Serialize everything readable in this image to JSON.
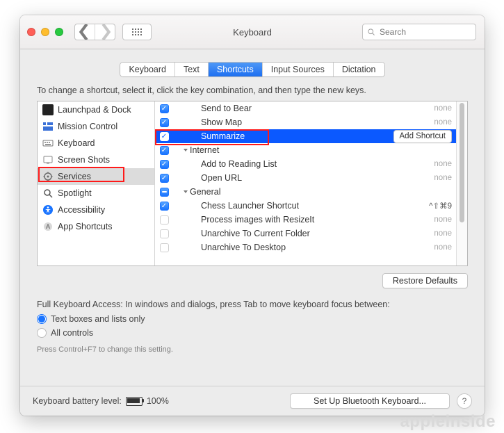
{
  "window": {
    "title": "Keyboard",
    "search_placeholder": "Search"
  },
  "tabs": [
    "Keyboard",
    "Text",
    "Shortcuts",
    "Input Sources",
    "Dictation"
  ],
  "active_tab_index": 2,
  "instructions": "To change a shortcut, select it, click the key combination, and then type the new keys.",
  "sidebar": {
    "items": [
      {
        "label": "Launchpad & Dock",
        "icon": "launchpad-icon"
      },
      {
        "label": "Mission Control",
        "icon": "mission-control-icon"
      },
      {
        "label": "Keyboard",
        "icon": "keyboard-icon"
      },
      {
        "label": "Screen Shots",
        "icon": "screenshots-icon"
      },
      {
        "label": "Services",
        "icon": "services-icon",
        "selected": true
      },
      {
        "label": "Spotlight",
        "icon": "spotlight-icon"
      },
      {
        "label": "Accessibility",
        "icon": "accessibility-icon"
      },
      {
        "label": "App Shortcuts",
        "icon": "app-shortcuts-icon"
      }
    ]
  },
  "tree": [
    {
      "type": "item",
      "checked": true,
      "label": "Send to Bear",
      "shortcut": "none"
    },
    {
      "type": "item",
      "checked": true,
      "label": "Show Map",
      "shortcut": "none"
    },
    {
      "type": "item",
      "checked": true,
      "label": "Summarize",
      "selected": true,
      "add_shortcut": true
    },
    {
      "type": "group",
      "checked": true,
      "label": "Internet",
      "expanded": true
    },
    {
      "type": "item",
      "checked": true,
      "label": "Add to Reading List",
      "shortcut": "none"
    },
    {
      "type": "item",
      "checked": true,
      "label": "Open URL",
      "shortcut": "none"
    },
    {
      "type": "group",
      "checked": "mixed",
      "label": "General",
      "expanded": true
    },
    {
      "type": "item",
      "checked": true,
      "label": "Chess Launcher Shortcut",
      "shortcut": "^⇧⌘9"
    },
    {
      "type": "item",
      "checked": false,
      "label": "Process images with ResizeIt",
      "shortcut": "none"
    },
    {
      "type": "item",
      "checked": false,
      "label": "Unarchive To Current Folder",
      "shortcut": "none"
    },
    {
      "type": "item",
      "checked": false,
      "label": "Unarchive To Desktop",
      "shortcut": "none"
    }
  ],
  "add_shortcut_label": "Add Shortcut",
  "restore_defaults_label": "Restore Defaults",
  "full_keyboard_access": {
    "heading": "Full Keyboard Access: In windows and dialogs, press Tab to move keyboard focus between:",
    "options": [
      "Text boxes and lists only",
      "All controls"
    ],
    "selected_index": 0,
    "hint": "Press Control+F7 to change this setting."
  },
  "bottom": {
    "battery_label": "Keyboard battery level:",
    "battery_level": "100%",
    "bluetooth_button": "Set Up Bluetooth Keyboard..."
  },
  "watermark": "appleinside"
}
